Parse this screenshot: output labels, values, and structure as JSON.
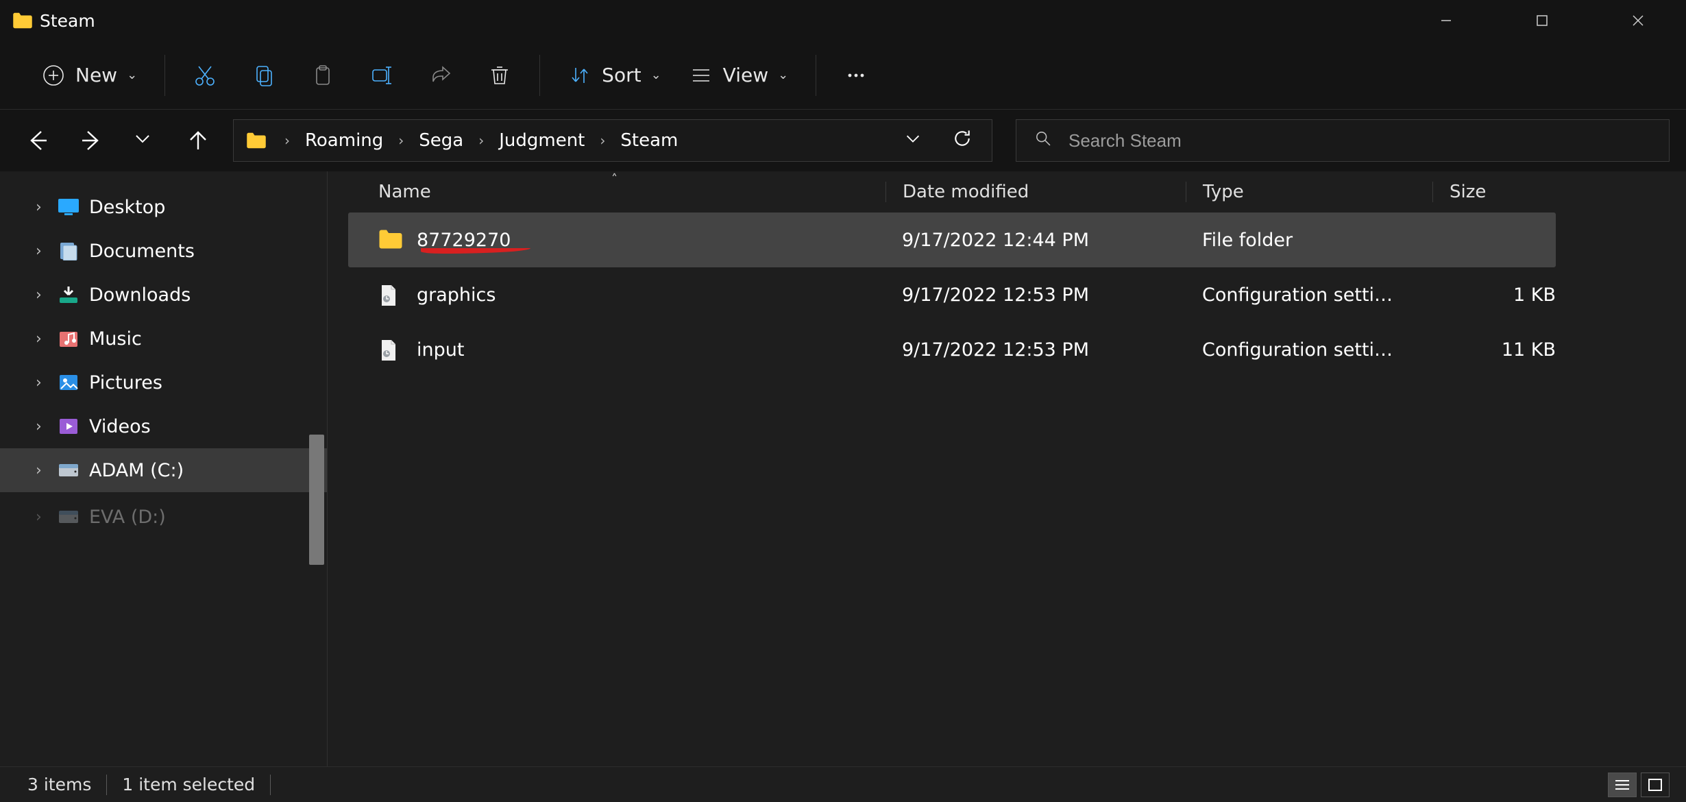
{
  "window": {
    "title": "Steam"
  },
  "toolbar": {
    "new_label": "New",
    "sort_label": "Sort",
    "view_label": "View"
  },
  "breadcrumb": {
    "segments": [
      "Roaming",
      "Sega",
      "Judgment",
      "Steam"
    ]
  },
  "search": {
    "placeholder": "Search Steam"
  },
  "sidebar": {
    "items": [
      {
        "label": "Desktop",
        "icon": "desktop",
        "color": "#2aa9ff"
      },
      {
        "label": "Documents",
        "icon": "documents",
        "color": "#7aa8d4"
      },
      {
        "label": "Downloads",
        "icon": "downloads",
        "color": "#19a88a"
      },
      {
        "label": "Music",
        "icon": "music",
        "color": "#e87272"
      },
      {
        "label": "Pictures",
        "icon": "pictures",
        "color": "#2a8fe6"
      },
      {
        "label": "Videos",
        "icon": "videos",
        "color": "#9a5cd6"
      },
      {
        "label": "ADAM (C:)",
        "icon": "drive",
        "color": "#bfc8d1",
        "selected": true
      },
      {
        "label": "EVA (D:)",
        "icon": "drive",
        "color": "#bfc8d1",
        "truncated": true
      }
    ]
  },
  "columns": {
    "name": "Name",
    "date": "Date modified",
    "type": "Type",
    "size": "Size"
  },
  "files": [
    {
      "name": "87729270",
      "date": "9/17/2022 12:44 PM",
      "type": "File folder",
      "size": "",
      "icon": "folder",
      "selected": true,
      "underlined": true
    },
    {
      "name": "graphics",
      "date": "9/17/2022 12:53 PM",
      "type": "Configuration setti…",
      "size": "1 KB",
      "icon": "config"
    },
    {
      "name": "input",
      "date": "9/17/2022 12:53 PM",
      "type": "Configuration setti…",
      "size": "11 KB",
      "icon": "config"
    }
  ],
  "status": {
    "item_count": "3 items",
    "selection": "1 item selected"
  }
}
